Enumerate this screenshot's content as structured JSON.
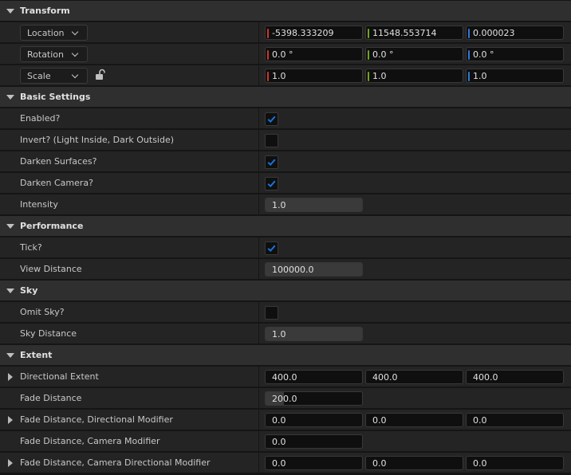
{
  "sections": {
    "transform": "Transform",
    "basic": "Basic Settings",
    "performance": "Performance",
    "sky": "Sky",
    "extent": "Extent"
  },
  "transform": {
    "location": {
      "label": "Location",
      "x": "-5398.333209",
      "y": "11548.553714",
      "z": "0.000023"
    },
    "rotation": {
      "label": "Rotation",
      "x": "0.0 °",
      "y": "0.0 °",
      "z": "0.0 °"
    },
    "scale": {
      "label": "Scale",
      "x": "1.0",
      "y": "1.0",
      "z": "1.0"
    }
  },
  "basic": {
    "enabled": {
      "label": "Enabled?",
      "checked": true
    },
    "invert": {
      "label": "Invert? (Light Inside, Dark Outside)",
      "checked": false
    },
    "darken_surfaces": {
      "label": "Darken Surfaces?",
      "checked": true
    },
    "darken_camera": {
      "label": "Darken Camera?",
      "checked": true
    },
    "intensity": {
      "label": "Intensity",
      "value": "1.0"
    }
  },
  "performance": {
    "tick": {
      "label": "Tick?",
      "checked": true
    },
    "view_distance": {
      "label": "View Distance",
      "value": "100000.0"
    }
  },
  "sky": {
    "omit_sky": {
      "label": "Omit Sky?",
      "checked": false
    },
    "sky_distance": {
      "label": "Sky Distance",
      "value": "1.0"
    }
  },
  "extent": {
    "directional_extent": {
      "label": "Directional Extent",
      "x": "400.0",
      "y": "400.0",
      "z": "400.0"
    },
    "fade_distance": {
      "label": "Fade Distance",
      "value": "200.0"
    },
    "fade_dir_mod": {
      "label": "Fade Distance, Directional Modifier",
      "x": "0.0",
      "y": "0.0",
      "z": "0.0"
    },
    "fade_cam_mod": {
      "label": "Fade Distance, Camera Modifier",
      "value": "0.0"
    },
    "fade_cam_dir_mod": {
      "label": "Fade Distance, Camera Directional Modifier",
      "x": "0.0",
      "y": "0.0",
      "z": "0.0"
    }
  },
  "colors": {
    "accent": "#1a73d9",
    "axis_x": "#c73a2b",
    "axis_y": "#6fa620",
    "axis_z": "#2f79d6"
  }
}
